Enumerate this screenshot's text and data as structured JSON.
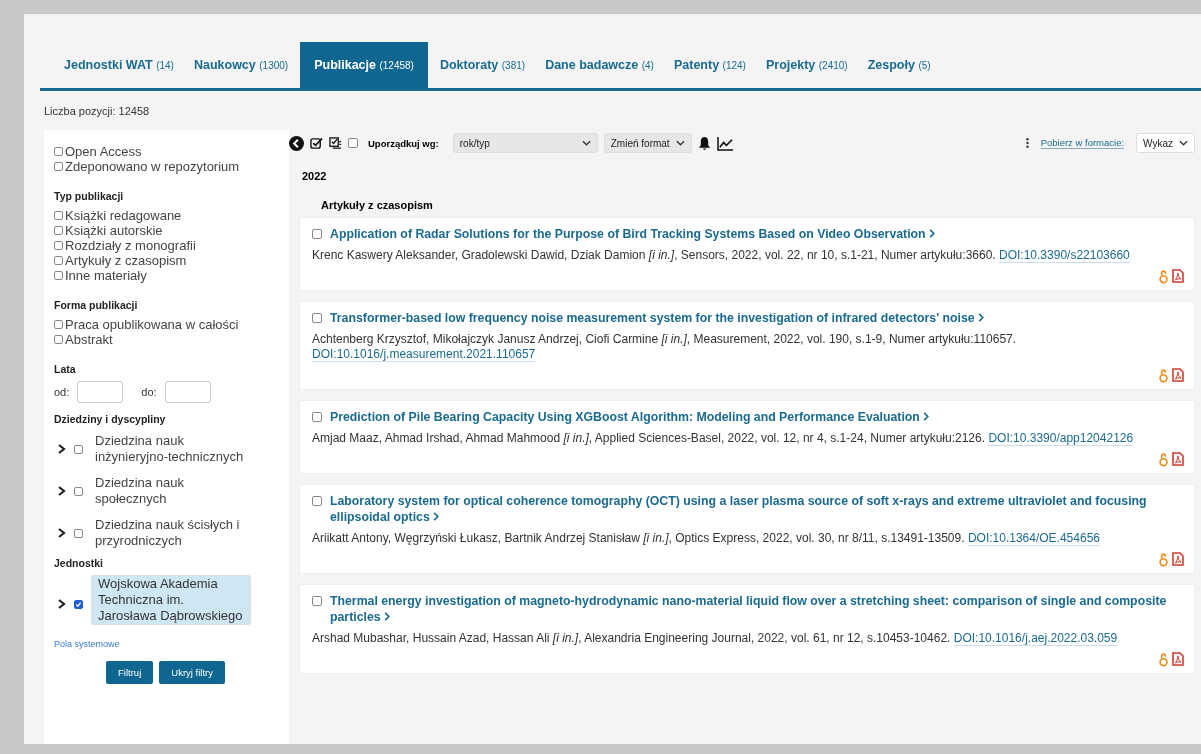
{
  "tabs": [
    {
      "label": "Jednostki WAT",
      "count": "(14)",
      "selected": false
    },
    {
      "label": "Naukowcy",
      "count": "(1300)",
      "selected": false
    },
    {
      "label": "Publikacje",
      "count": "(12458)",
      "selected": true
    },
    {
      "label": "Doktoraty",
      "count": "(381)",
      "selected": false
    },
    {
      "label": "Dane badawcze",
      "count": "(4)",
      "selected": false
    },
    {
      "label": "Patenty",
      "count": "(124)",
      "selected": false
    },
    {
      "label": "Projekty",
      "count": "(2410)",
      "selected": false
    },
    {
      "label": "Zespoły",
      "count": "(5)",
      "selected": false
    }
  ],
  "result_count": "Liczba pozycji: 12458",
  "filters": {
    "flags": [
      {
        "label": "Open Access",
        "checked": false
      },
      {
        "label": "Zdeponowano w repozytorium",
        "checked": false
      }
    ],
    "groups": [
      {
        "title": "Typ publikacji",
        "options": [
          {
            "label": "Książki redagowane",
            "checked": false
          },
          {
            "label": "Książki autorskie",
            "checked": false
          },
          {
            "label": "Rozdziały z monografii",
            "checked": false
          },
          {
            "label": "Artykuły z czasopism",
            "checked": false
          },
          {
            "label": "Inne materiały",
            "checked": false
          }
        ]
      },
      {
        "title": "Forma publikacji",
        "options": [
          {
            "label": "Praca opublikowana w całości",
            "checked": false
          },
          {
            "label": "Abstrakt",
            "checked": false
          }
        ]
      }
    ],
    "years": {
      "title": "Lata",
      "from_label": "od:",
      "to_label": "do:"
    },
    "trees": [
      {
        "title": "Dziedziny i dyscypliny",
        "items": [
          {
            "label": "Dziedzina nauk inżynieryjno-technicznych",
            "checked": false,
            "expanded": false
          },
          {
            "label": "Dziedzina nauk społecznych",
            "checked": false,
            "expanded": false
          },
          {
            "label": "Dziedzina nauk ścisłych i przyrodniczych",
            "checked": false,
            "expanded": false
          }
        ]
      },
      {
        "title": "Jednostki",
        "items": [
          {
            "label": "Wojskowa Akademia Techniczna im. Jarosława Dąbrowskiego",
            "checked": true,
            "expanded": false
          }
        ]
      }
    ],
    "system_link": "Pola systemowe",
    "buttons": [
      "Filtruj",
      "Ukryj filtry"
    ]
  },
  "toolbar": {
    "select_all_checked": false,
    "sort_label": "Uporządkuj wg:",
    "sort_value": "rok/typ",
    "format_value": "Zmień format",
    "download_link": "Pobierz w formacie:",
    "download_value": "Wykaz"
  },
  "year": "2022",
  "category": "Artykuły z czasopism",
  "publications": [
    {
      "title": "Application of Radar Solutions for the Purpose of Bird Tracking Systems Based on Video Observation",
      "citation": "Krenc Kaswery Aleksander, Gradolewski Dawid, Dziak Damion *[i in.]*, Sensors, 2022, vol. 22, nr 10, s.1-21, Numer artykułu:3660.",
      "doi": "DOI:10.3390/s22103660",
      "checked": false,
      "open_access": true,
      "pdf": true
    },
    {
      "title": "Transformer-based low frequency noise measurement system for the investigation of infrared detectors' noise",
      "citation": "Achtenberg Krzysztof, Mikołajczyk Janusz Andrzej, Ciofi Carmine *[i in.]*, Measurement, 2022, vol. 190, s.1-9, Numer artykułu:110657.",
      "doi": "DOI:10.1016/j.measurement.2021.110657",
      "checked": false,
      "open_access": true,
      "pdf": true
    },
    {
      "title": "Prediction of Pile Bearing Capacity Using XGBoost Algorithm: Modeling and Performance Evaluation",
      "citation": "Amjad Maaz, Ahmad Irshad, Ahmad Mahmood *[i in.]*, Applied Sciences-Basel, 2022, vol. 12, nr 4, s.1-24, Numer artykułu:2126.",
      "doi": "DOI:10.3390/app12042126",
      "checked": false,
      "open_access": true,
      "pdf": true
    },
    {
      "title": "Laboratory system for optical coherence tomography (OCT) using a laser plasma source of soft x-rays and extreme ultraviolet and focusing ellipsoidal optics",
      "citation": "Ariikatt Antony, Węgrzyński Łukasz, Bartnik Andrzej Stanisław *[i in.]*, Optics Express, 2022, vol. 30, nr 8/11, s.13491-13509.",
      "doi": "DOI:10.1364/OE.454656",
      "checked": false,
      "open_access": true,
      "pdf": true
    },
    {
      "title": "Thermal energy investigation of magneto-hydrodynamic nano-material liquid flow over a stretching sheet: comparison of single and composite particles",
      "citation": "Arshad Mubashar, Hussain Azad, Hassan Ali *[i in.]*, Alexandria Engineering Journal, 2022, vol. 61, nr 12, s.10453-10462.",
      "doi": "DOI:10.1016/j.aej.2022.03.059",
      "checked": false,
      "open_access": true,
      "pdf": true
    }
  ]
}
